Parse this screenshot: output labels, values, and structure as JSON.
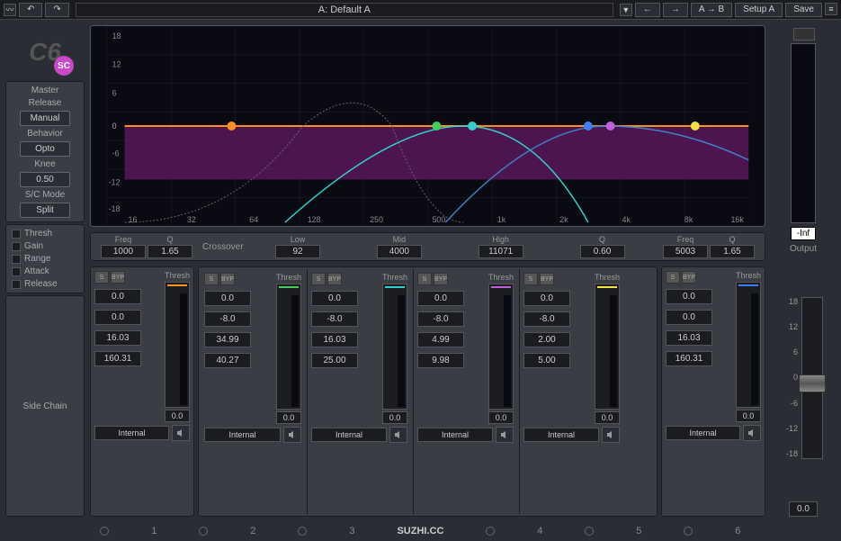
{
  "topbar": {
    "preset": "A: Default A",
    "ab": "A → B",
    "setup": "Setup A",
    "save": "Save"
  },
  "logo": {
    "text": "C6",
    "sc": "SC"
  },
  "master": {
    "title": "Master",
    "release_label": "Release",
    "release": "Manual",
    "behavior_label": "Behavior",
    "behavior": "Opto",
    "knee_label": "Knee",
    "knee": "0.50",
    "scmode_label": "S/C Mode",
    "scmode": "Split"
  },
  "side_rows": [
    "Thresh",
    "Gain",
    "Range",
    "Attack",
    "Release"
  ],
  "side_chain_label": "Side Chain",
  "graph": {
    "y_ticks": [
      "18",
      "12",
      "6",
      "0",
      "-6",
      "-12",
      "-18"
    ],
    "x_ticks": [
      "16",
      "32",
      "64",
      "128",
      "250",
      "500",
      "1k",
      "2k",
      "4k",
      "8k",
      "16k"
    ]
  },
  "crossover": {
    "freq_label": "Freq",
    "q_label": "Q",
    "crossover_label": "Crossover",
    "low_label": "Low",
    "mid_label": "Mid",
    "high_label": "High",
    "band1_freq": "1000",
    "band1_q": "1.65",
    "low": "92",
    "mid": "4000",
    "high": "11071",
    "q": "0.60",
    "band6_freq": "5003",
    "band6_q": "1.65"
  },
  "bands": [
    {
      "color": "#ff9020",
      "s": "S",
      "byp": "BYP",
      "thresh_label": "Thresh",
      "v1": "0.0",
      "v2": "0.0",
      "v3": "16.03",
      "v4": "160.31",
      "tb": "0.0",
      "sc": "Internal"
    },
    {
      "color": "#40d060",
      "s": "S",
      "byp": "BYP",
      "thresh_label": "Thresh",
      "v1": "0.0",
      "v2": "-8.0",
      "v3": "34.99",
      "v4": "40.27",
      "tb": "0.0",
      "sc": "Internal"
    },
    {
      "color": "#30d0d0",
      "s": "S",
      "byp": "BYP",
      "thresh_label": "Thresh",
      "v1": "0.0",
      "v2": "-8.0",
      "v3": "16.03",
      "v4": "25.00",
      "tb": "0.0",
      "sc": "Internal"
    },
    {
      "color": "#c060e0",
      "s": "S",
      "byp": "BYP",
      "thresh_label": "Thresh",
      "v1": "0.0",
      "v2": "-8.0",
      "v3": "4.99",
      "v4": "9.98",
      "tb": "0.0",
      "sc": "Internal"
    },
    {
      "color": "#f0e040",
      "s": "S",
      "byp": "BYP",
      "thresh_label": "Thresh",
      "v1": "0.0",
      "v2": "-8.0",
      "v3": "2.00",
      "v4": "5.00",
      "tb": "0.0",
      "sc": "Internal"
    },
    {
      "color": "#4080ff",
      "s": "S",
      "byp": "BYP",
      "thresh_label": "Thresh",
      "v1": "0.0",
      "v2": "0.0",
      "v3": "16.03",
      "v4": "160.31",
      "tb": "0.0",
      "sc": "Internal"
    }
  ],
  "output": {
    "peak": "-Inf",
    "label": "Output",
    "scale": [
      "18",
      "12",
      "6",
      "0",
      "-6",
      "-12",
      "-18"
    ],
    "value": "0.0"
  },
  "bottom": [
    "1",
    "2",
    "3",
    "4",
    "5",
    "6"
  ],
  "watermark": "SUZHI.CC"
}
